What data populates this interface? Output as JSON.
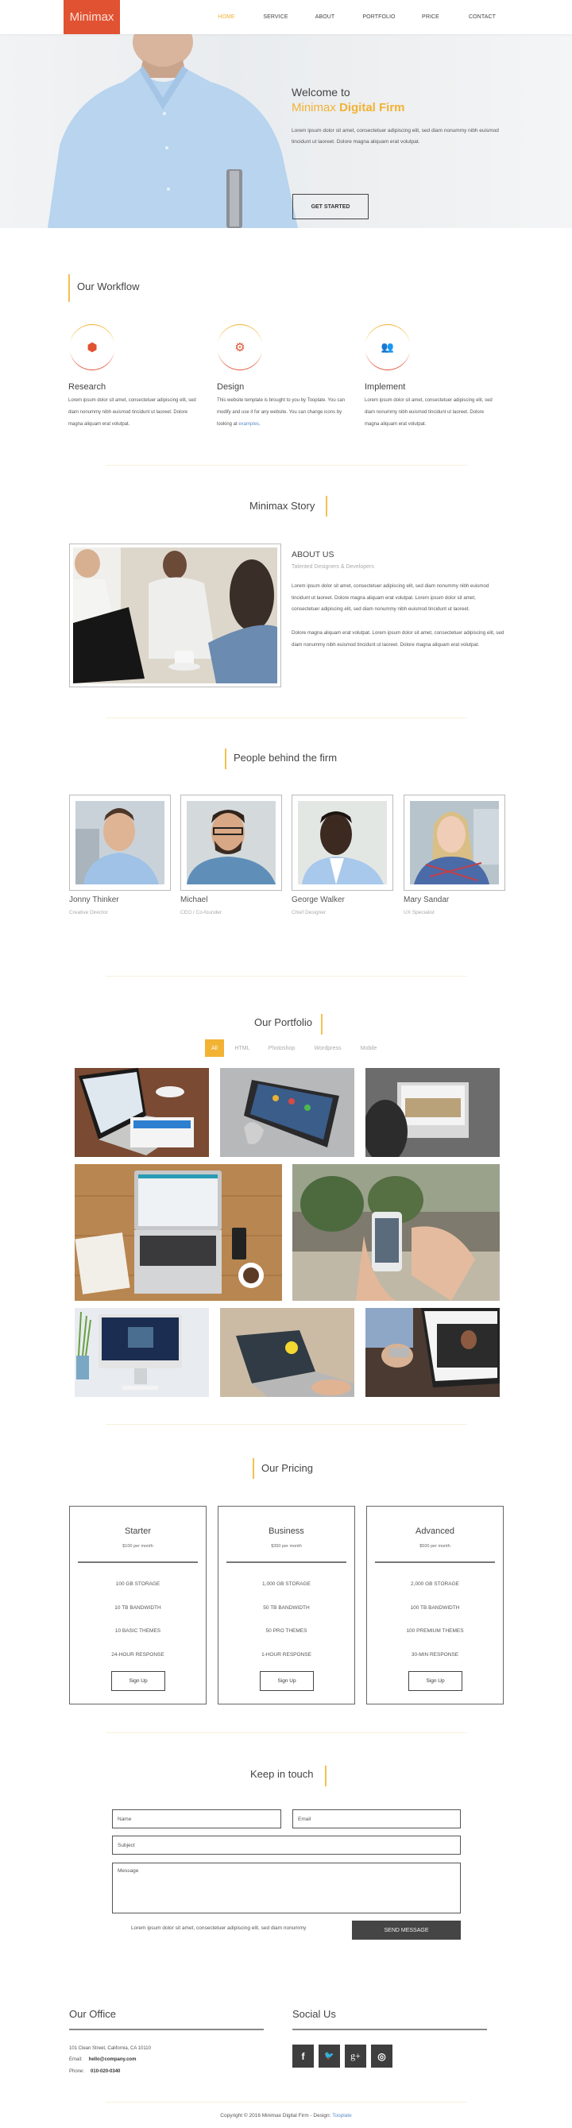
{
  "nav": {
    "logo": "Minimax",
    "items": [
      {
        "label": "HOME",
        "active": true
      },
      {
        "label": "SERVICE",
        "active": false
      },
      {
        "label": "ABOUT",
        "active": false
      },
      {
        "label": "PORTFOLIO",
        "active": false
      },
      {
        "label": "PRICE",
        "active": false
      },
      {
        "label": "CONTACT",
        "active": false
      }
    ]
  },
  "hero": {
    "title_line1": "Welcome to",
    "title_line2_light": "Minimax ",
    "title_line2_bold": "Digital Firm",
    "text": "Lorem ipsum dolor sit amet, consectetuer adipiscing elit, sed diam nonummy nibh euismod tincidunt ut laoreet. Dolore magna aliquam erat volutpat.",
    "button": "GET STARTED"
  },
  "workflow": {
    "title": "Our Workflow",
    "items": [
      {
        "icon": "cubes-icon",
        "glyph": "⬢",
        "title": "Research",
        "text": "Lorem ipsum dolor sit amet, consectetuer adipiscing elit, sed diam nonummy nibh euismod tincidunt ut laoreet. Dolore magna aliquam erat volutpat."
      },
      {
        "icon": "cogs-icon",
        "glyph": "⚙",
        "title": "Design",
        "text": "This website template is brought to you by Tooplate. You can modify and use it for any website. You can change icons by looking at ",
        "link": "examples",
        "after": "."
      },
      {
        "icon": "users-icon",
        "glyph": "👥",
        "title": "Implement",
        "text": "Lorem ipsum dolor sit amet, consectetuer adipiscing elit, sed diam nonummy nibh euismod tincidunt ut laoreet. Dolore magna aliquam erat volutpat."
      }
    ]
  },
  "story": {
    "title": "Minimax Story",
    "about_title": "ABOUT US",
    "about_subtitle": "Talented Designers & Developers",
    "paragraphs": [
      "Lorem ipsum dolor sit amet, consectetuer adipiscing elit, sed diam nonummy nibh euismod tincidunt ut laoreet. Dolore magna aliquam erat volutpat. Lorem ipsum dolor sit amet, consectetuer adipiscing elit, sed diam nonummy nibh euismod tincidunt ut laoreet.",
      "Dolore magna aliquam erat volutpat. Lorem ipsum dolor sit amet, consectetuer adipiscing elit, sed diam nonummy nibh euismod tincidunt ut laoreet. Dolore magna aliquam erat volutpat."
    ]
  },
  "team": {
    "title": "People behind the firm",
    "members": [
      {
        "name": "Jonny Thinker",
        "role": "Creative Director"
      },
      {
        "name": "Michael",
        "role": "CEO / Co-founder"
      },
      {
        "name": "George Walker",
        "role": "Chief Designer"
      },
      {
        "name": "Mary Sandar",
        "role": "UX Specialist"
      }
    ]
  },
  "portfolio": {
    "title": "Our Portfolio",
    "tabs": [
      {
        "label": "All",
        "active": true
      },
      {
        "label": "HTML",
        "active": false
      },
      {
        "label": "Photoshop",
        "active": false
      },
      {
        "label": "Wordpress",
        "active": false
      },
      {
        "label": "Mobile",
        "active": false
      }
    ],
    "images": [
      "laptop-and-tablet-photo",
      "smartphone-on-macbook-photo",
      "imac-browsing-photo",
      "laptop-on-desk-photo",
      "hands-with-iphone-photo",
      "imac-with-plant-photo",
      "laptop-typing-photo",
      "laptop-website-photo"
    ]
  },
  "pricing": {
    "title": "Our Pricing",
    "plans": [
      {
        "name": "Starter",
        "price": "$100 per month",
        "features": [
          "100 GB STORAGE",
          "10 TB BANDWIDTH",
          "10 BASIC THEMES",
          "24-HOUR RESPONSE"
        ],
        "button": "Sign Up"
      },
      {
        "name": "Business",
        "price": "$350 per month",
        "features": [
          "1,000 GB STORAGE",
          "50 TB BANDWIDTH",
          "50 PRO THEMES",
          "1-HOUR RESPONSE"
        ],
        "button": "Sign Up"
      },
      {
        "name": "Advanced",
        "price": "$500 per month",
        "features": [
          "2,000 GB STORAGE",
          "100 TB BANDWIDTH",
          "100 PREMIUM THEMES",
          "30-MIN RESPONSE"
        ],
        "button": "Sign Up"
      }
    ]
  },
  "contact": {
    "title": "Keep in touch",
    "name_placeholder": "Name",
    "email_placeholder": "Email",
    "subject_placeholder": "Subject",
    "message_placeholder": "Message",
    "note": "Lorem ipsum dolor sit amet, consectetuer adipiscing elit, sed diam nonummy",
    "button": "SEND MESSAGE"
  },
  "footer": {
    "office_title": "Our Office",
    "address": "101 Clean Street, California, CA 10110",
    "email_label": "Email:",
    "email": "hello@company.com",
    "phone_label": "Phone:",
    "phone": "010-020-0340",
    "social_title": "Social Us",
    "social": [
      {
        "name": "facebook-icon",
        "glyph": "f"
      },
      {
        "name": "twitter-icon",
        "glyph": "🐦"
      },
      {
        "name": "google-plus-icon",
        "glyph": "g+"
      },
      {
        "name": "dribbble-icon",
        "glyph": "◎"
      }
    ],
    "copyright": "Copyright © 2016 Minimax Digital Firm - Design: ",
    "copyright_link": "Tooplate"
  },
  "colors": {
    "accent": "#f2b233",
    "brand": "#e15232",
    "dark_button": "#454545"
  }
}
